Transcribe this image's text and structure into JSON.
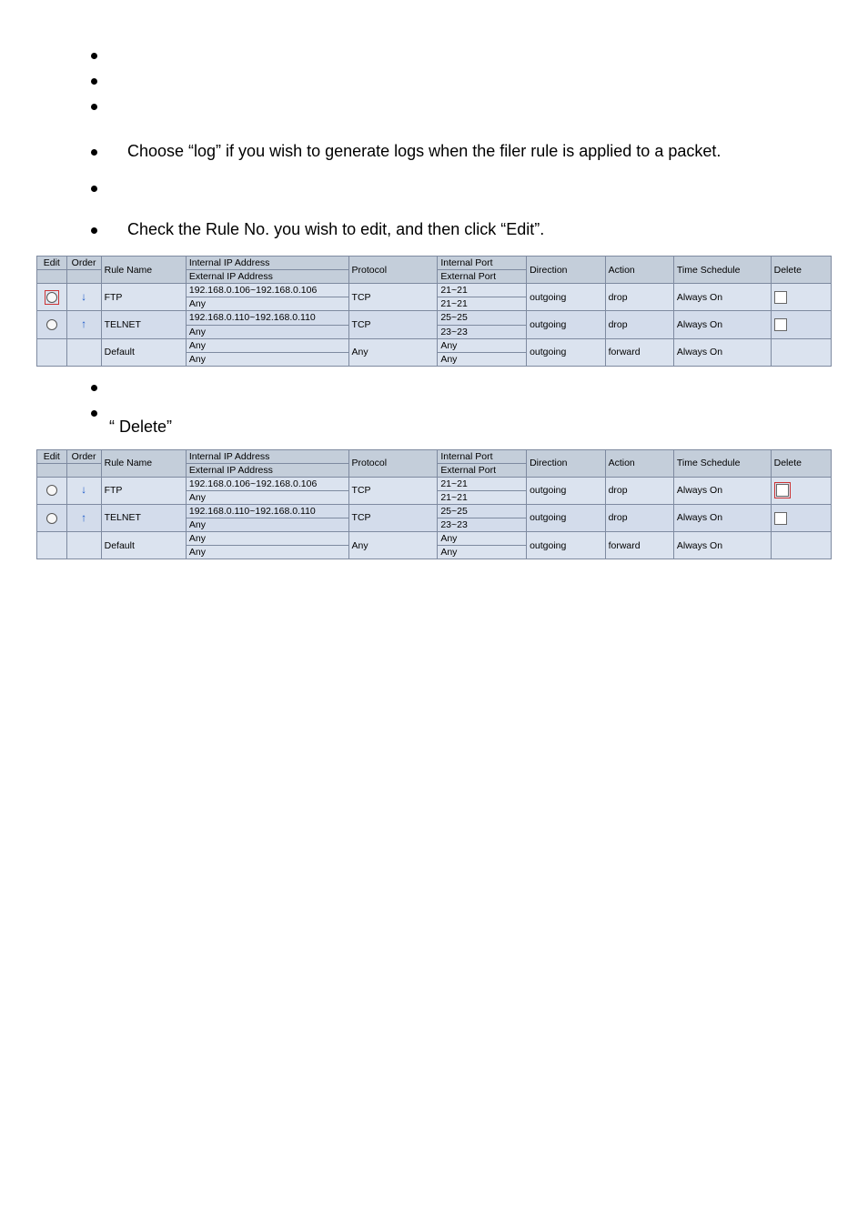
{
  "bullets": {
    "log_line": "Choose “log” if you wish to generate logs when the filer rule is applied to a packet.",
    "edit_line": "Check the Rule No. you wish to edit, and then click “Edit”.",
    "delete_line": "“       Delete”"
  },
  "headers": {
    "edit": "Edit",
    "order": "Order",
    "rule_name": "Rule Name",
    "internal_ip": "Internal IP Address",
    "external_ip": "External IP Address",
    "protocol": "Protocol",
    "internal_port": "Internal Port",
    "external_port": "External Port",
    "direction": "Direction",
    "action": "Action",
    "time_schedule": "Time Schedule",
    "delete": "Delete"
  },
  "rows": [
    {
      "name": "FTP",
      "int_ip": "192.168.0.106~192.168.0.106",
      "ext_ip": "Any",
      "proto": "TCP",
      "int_port": "21~21",
      "ext_port": "21~21",
      "direction": "outgoing",
      "action": "drop",
      "time": "Always On",
      "arrow": "down",
      "has_delete": true
    },
    {
      "name": "TELNET",
      "int_ip": "192.168.0.110~192.168.0.110",
      "ext_ip": "Any",
      "proto": "TCP",
      "int_port": "25~25",
      "ext_port": "23~23",
      "direction": "outgoing",
      "action": "drop",
      "time": "Always On",
      "arrow": "up",
      "has_delete": true
    },
    {
      "name": "Default",
      "int_ip": "Any",
      "ext_ip": "Any",
      "proto": "Any",
      "int_port": "Any",
      "ext_port": "Any",
      "direction": "outgoing",
      "action": "forward",
      "time": "Always On",
      "arrow": "",
      "has_delete": false
    }
  ]
}
